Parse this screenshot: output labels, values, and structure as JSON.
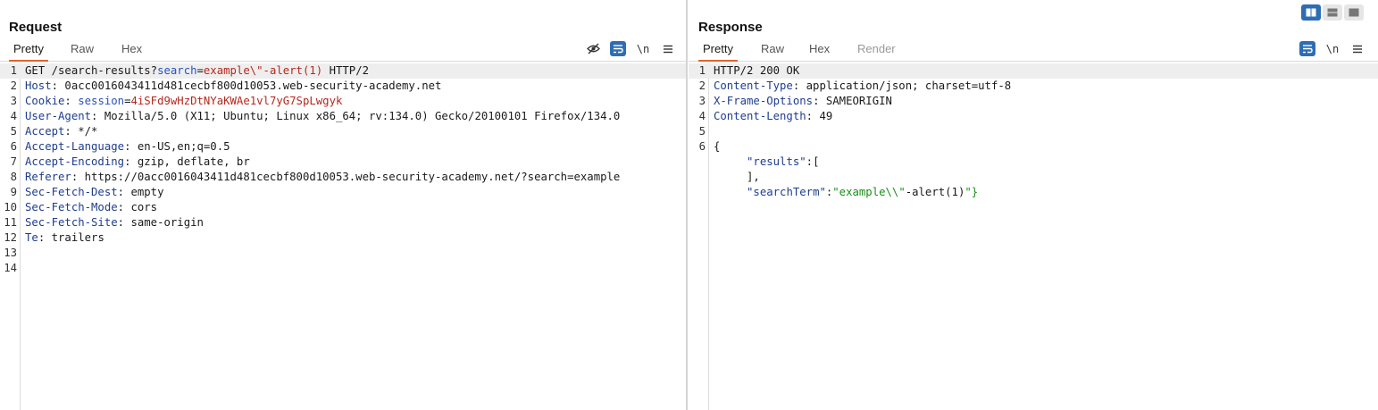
{
  "request": {
    "title": "Request",
    "tabs": [
      "Pretty",
      "Raw",
      "Hex"
    ],
    "active_tab": "Pretty",
    "toolbar": {
      "hide_icon": "eye-slash-icon",
      "wrap_icon": "word-wrap-icon",
      "newline_label": "\\n",
      "menu_icon": "hamburger-menu-icon"
    },
    "lines": [
      {
        "n": "1",
        "parts": [
          [
            "GET /search-results?",
            ""
          ],
          [
            "search",
            "pn"
          ],
          [
            "=",
            ""
          ],
          [
            "example\\\"-alert(1)",
            "pv"
          ],
          [
            " HTTP/2",
            ""
          ]
        ]
      },
      {
        "n": "2",
        "parts": [
          [
            "Host",
            "hk"
          ],
          [
            ": 0acc0016043411d481cecbf800d10053.web-security-academy.net",
            ""
          ]
        ]
      },
      {
        "n": "3",
        "parts": [
          [
            "Cookie",
            "hk"
          ],
          [
            ": ",
            ""
          ],
          [
            "session",
            "pn"
          ],
          [
            "=",
            ""
          ],
          [
            "4iSFd9wHzDtNYaKWAe1vl7yG7SpLwgyk",
            "pv"
          ]
        ]
      },
      {
        "n": "4",
        "parts": [
          [
            "User-Agent",
            "hk"
          ],
          [
            ": Mozilla/5.0 (X11; Ubuntu; Linux x86_64; rv:134.0) Gecko/20100101 Firefox/134.0",
            ""
          ]
        ]
      },
      {
        "n": "5",
        "parts": [
          [
            "Accept",
            "hk"
          ],
          [
            ": */*",
            ""
          ]
        ]
      },
      {
        "n": "6",
        "parts": [
          [
            "Accept-Language",
            "hk"
          ],
          [
            ": en-US,en;q=0.5",
            ""
          ]
        ]
      },
      {
        "n": "7",
        "parts": [
          [
            "Accept-Encoding",
            "hk"
          ],
          [
            ": gzip, deflate, br",
            ""
          ]
        ]
      },
      {
        "n": "8",
        "parts": [
          [
            "Referer",
            "hk"
          ],
          [
            ": https://0acc0016043411d481cecbf800d10053.web-security-academy.net/?search=example",
            ""
          ]
        ]
      },
      {
        "n": "9",
        "parts": [
          [
            "Sec-Fetch-Dest",
            "hk"
          ],
          [
            ": empty",
            ""
          ]
        ]
      },
      {
        "n": "10",
        "parts": [
          [
            "Sec-Fetch-Mode",
            "hk"
          ],
          [
            ": cors",
            ""
          ]
        ]
      },
      {
        "n": "11",
        "parts": [
          [
            "Sec-Fetch-Site",
            "hk"
          ],
          [
            ": same-origin",
            ""
          ]
        ]
      },
      {
        "n": "12",
        "parts": [
          [
            "Te",
            "hk"
          ],
          [
            ": trailers",
            ""
          ]
        ]
      },
      {
        "n": "13",
        "parts": []
      },
      {
        "n": "14",
        "parts": []
      }
    ]
  },
  "response": {
    "title": "Response",
    "tabs": [
      "Pretty",
      "Raw",
      "Hex",
      "Render"
    ],
    "active_tab": "Pretty",
    "disabled_tabs": [
      "Render"
    ],
    "toolbar": {
      "wrap_icon": "word-wrap-icon",
      "newline_label": "\\n",
      "menu_icon": "hamburger-menu-icon"
    },
    "lines": [
      {
        "n": "1",
        "parts": [
          [
            "HTTP/2 200 OK",
            ""
          ]
        ]
      },
      {
        "n": "2",
        "parts": [
          [
            "Content-Type",
            "hk"
          ],
          [
            ": application/json; charset=utf-8",
            ""
          ]
        ]
      },
      {
        "n": "3",
        "parts": [
          [
            "X-Frame-Options",
            "hk"
          ],
          [
            ": SAMEORIGIN",
            ""
          ]
        ]
      },
      {
        "n": "4",
        "parts": [
          [
            "Content-Length",
            "hk"
          ],
          [
            ": 49",
            ""
          ]
        ]
      },
      {
        "n": "5",
        "parts": []
      },
      {
        "n": "6",
        "parts": [
          [
            "{",
            ""
          ]
        ]
      },
      {
        "n": "",
        "parts": [
          [
            "     ",
            ""
          ],
          [
            "\"results\"",
            "js-key"
          ],
          [
            ":[",
            ""
          ]
        ]
      },
      {
        "n": "",
        "parts": [
          [
            "     ],",
            ""
          ]
        ]
      },
      {
        "n": "",
        "parts": [
          [
            "     ",
            ""
          ],
          [
            "\"searchTerm\"",
            "js-key"
          ],
          [
            ":",
            ""
          ],
          [
            "\"example\\\\\"",
            "js-str"
          ],
          [
            "-alert(1)",
            ""
          ],
          [
            "\"}",
            "js-str"
          ]
        ]
      }
    ]
  },
  "layout_toggle": {
    "options": [
      "side-by-side",
      "stacked",
      "single"
    ],
    "active": "side-by-side"
  },
  "colors": {
    "accent_tab": "#e8602c",
    "toolbar_active": "#2e6db4",
    "header_key": "#1e3d8f",
    "param_value": "#b5281e",
    "json_string": "#1a8f1a"
  }
}
